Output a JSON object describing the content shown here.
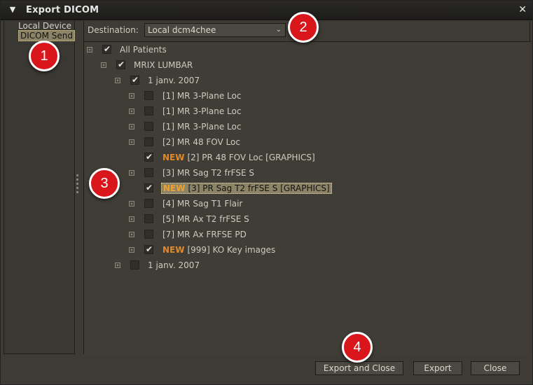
{
  "window": {
    "title": "Export DICOM"
  },
  "sidebar": {
    "items": [
      {
        "label": "Local Device"
      },
      {
        "label": "DICOM Send"
      }
    ]
  },
  "destination": {
    "label": "Destination:",
    "value": "Local dcm4chee"
  },
  "tree": {
    "nodes": [
      {
        "label": "All Patients",
        "checked": true
      },
      {
        "label": "MRIX LUMBAR",
        "checked": true
      },
      {
        "label": "1 janv. 2007",
        "checked": true
      },
      {
        "label": "[1] MR 3-Plane Loc",
        "checked": false
      },
      {
        "label": "[1] MR 3-Plane Loc",
        "checked": false
      },
      {
        "label": "[1] MR 3-Plane Loc",
        "checked": false
      },
      {
        "label": "[2] MR 48 FOV Loc",
        "checked": false
      },
      {
        "new": "NEW",
        "label": "[2] PR 48 FOV Loc [GRAPHICS]",
        "checked": true
      },
      {
        "label": "[3] MR Sag T2 frFSE S",
        "checked": false
      },
      {
        "new": "NEW",
        "label": "[3] PR Sag T2 frFSE S [GRAPHICS]",
        "checked": true
      },
      {
        "label": "[4] MR Sag T1 Flair",
        "checked": false
      },
      {
        "label": "[5] MR Ax T2 frFSE S",
        "checked": false
      },
      {
        "label": "[7] MR Ax FRFSE PD",
        "checked": false
      },
      {
        "new": "NEW",
        "label": "[999] KO Key images",
        "checked": true
      },
      {
        "label": "1 janv. 2007",
        "checked": false
      }
    ]
  },
  "buttons": {
    "export_close": "Export and Close",
    "export": "Export",
    "close": "Close"
  },
  "callouts": [
    "1",
    "2",
    "3",
    "4"
  ],
  "colors": {
    "new_badge": "#e08a2c",
    "callout": "#d9161b",
    "selection": "#8d8468"
  }
}
